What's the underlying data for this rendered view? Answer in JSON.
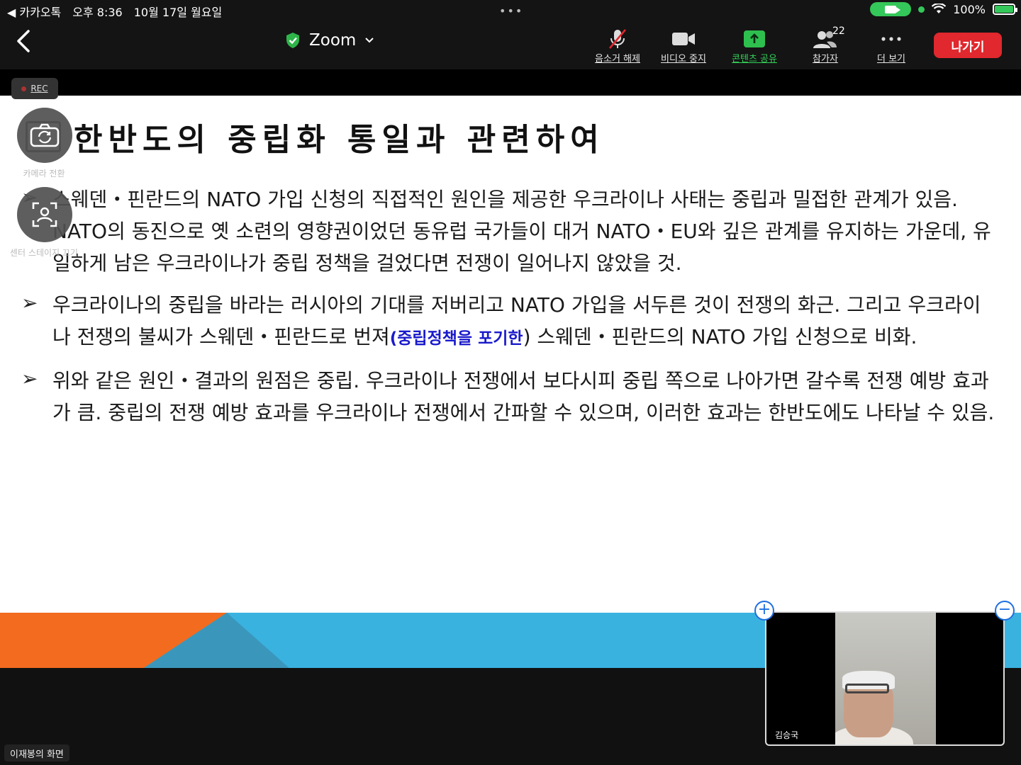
{
  "status_bar": {
    "back_app": "◀ 카카오톡",
    "time": "오후 8:36",
    "date": "10월 17일 월요일",
    "battery": "100%"
  },
  "toolbar": {
    "title": "Zoom",
    "mute_label": "음소거 해제",
    "video_label": "비디오 중지",
    "share_label": "콘텐츠 공유",
    "participants_label": "참가자",
    "participants_count": "22",
    "more_label": "더 보기",
    "leave_label": "나가기"
  },
  "rec_label": "REC",
  "camera_switch_label": "카메라 전환",
  "center_stage_label": "센터 스테이지 끄기",
  "slide": {
    "title": "한반도의 중립화 통일과 관련하여",
    "bullets": [
      {
        "text": "스웨덴・핀란드의 NATO 가입 신청의 직접적인 원인을 제공한 우크라이나 사태는 중립과 밀접한 관계가 있음. NATO의 동진으로 옛 소련의 영향권이었던 동유럽 국가들이 대거 NATO・EU와 깊은 관계를 유지하는 가운데, 유일하게 남은 우크라이나가 중립 정책을 걸었다면 전쟁이 일어나지 않았을 것."
      },
      {
        "text_before": "우크라이나의 중립을 바라는 러시아의 기대를 저버리고 NATO 가입을 서두른 것이 전쟁의 화근. 그리고 우크라이나 전쟁의 불씨가 스웨덴・핀란드로 번져",
        "highlight": "(중립정책을 포기한",
        "text_after": ") 스웨덴・핀란드의 NATO 가입 신청으로 비화."
      },
      {
        "text": "위와 같은 원인・결과의 원점은 중립. 우크라이나 전쟁에서 보다시피 중립 쪽으로 나아가면 갈수록 전쟁 예방 효과가 큼. 중립의 전쟁 예방 효과를 우크라이나 전쟁에서 간파할 수 있으며, 이러한 효과는 한반도에도 나타날 수 있음."
      }
    ]
  },
  "screen_owner": "이재봉의 화면",
  "video_tile": {
    "participant_name": "김승국"
  },
  "colors": {
    "leave_red": "#e0282e",
    "share_green": "#34d058",
    "band_blue": "#3ab2e0",
    "band_orange": "#f26b1f",
    "band_teal": "#3a97bb"
  }
}
